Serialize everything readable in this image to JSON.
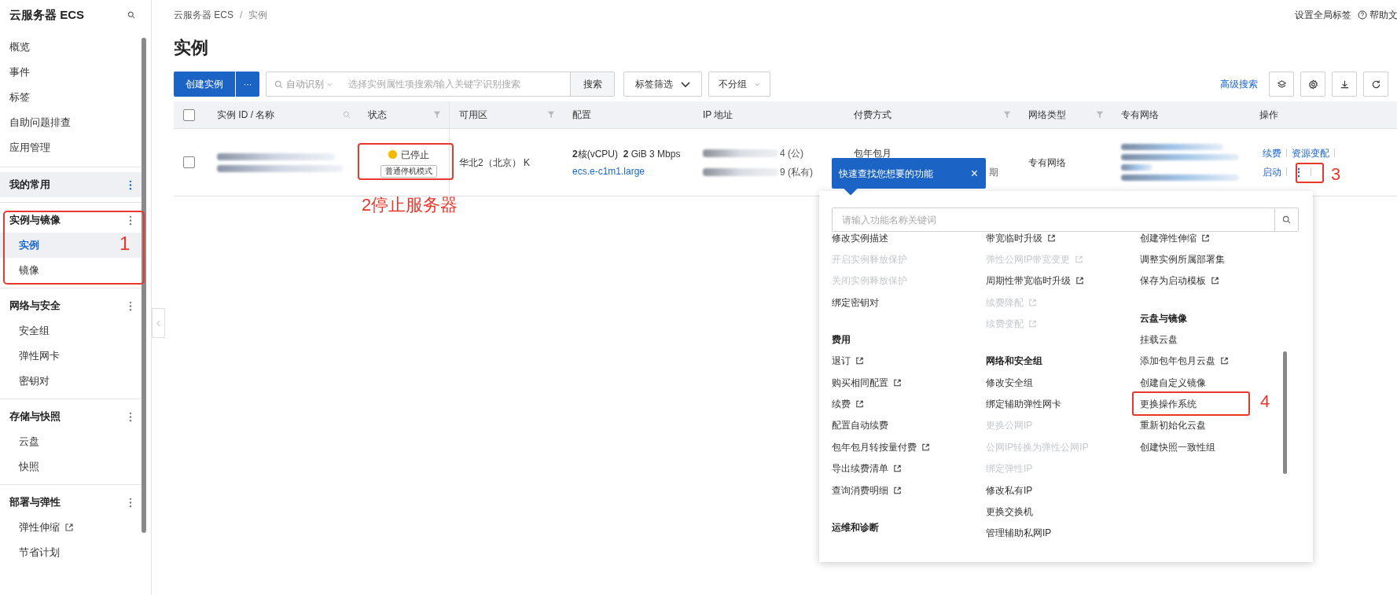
{
  "sidebar": {
    "title": "云服务器 ECS",
    "top_items": [
      {
        "label": "概览"
      },
      {
        "label": "事件"
      },
      {
        "label": "标签"
      },
      {
        "label": "自助问题排查"
      },
      {
        "label": "应用管理"
      }
    ],
    "sections": [
      {
        "title": "我的常用",
        "selected": true
      },
      {
        "title": "实例与镜像",
        "selected": false,
        "items": [
          {
            "label": "实例",
            "selected": true,
            "external": false
          },
          {
            "label": "镜像",
            "selected": false,
            "external": false
          }
        ]
      },
      {
        "title": "网络与安全",
        "selected": false,
        "items": [
          {
            "label": "安全组",
            "selected": false,
            "external": false
          },
          {
            "label": "弹性网卡",
            "selected": false,
            "external": false
          },
          {
            "label": "密钥对",
            "selected": false,
            "external": false
          }
        ]
      },
      {
        "title": "存储与快照",
        "selected": false,
        "items": [
          {
            "label": "云盘",
            "selected": false,
            "external": false
          },
          {
            "label": "快照",
            "selected": false,
            "external": false
          }
        ]
      },
      {
        "title": "部署与弹性",
        "selected": false,
        "items": [
          {
            "label": "弹性伸缩",
            "selected": false,
            "external": true
          },
          {
            "label": "节省计划",
            "selected": false,
            "external": false
          }
        ]
      }
    ]
  },
  "breadcrumb": {
    "items": [
      "云服务器 ECS",
      "实例"
    ],
    "separator": "/"
  },
  "header_links": [
    {
      "label": "设置全局标签",
      "kind": "text"
    },
    {
      "label": "帮助文",
      "kind": "help"
    }
  ],
  "page_title": "实例",
  "toolbar": {
    "create_button": "创建实例",
    "more_button": "···",
    "search_scope": "自动识别",
    "search_placeholder": "选择实例属性项搜索/输入关键字识别搜索",
    "search_button": "搜索",
    "tag_filter": "标签筛选",
    "group_select": "不分组",
    "advanced_search": "高级搜索"
  },
  "table": {
    "all_selected": false,
    "columns": [
      {
        "label": "实例 ID / 名称"
      },
      {
        "label": "状态"
      },
      {
        "label": "可用区"
      },
      {
        "label": "配置"
      },
      {
        "label": "IP 地址"
      },
      {
        "label": "付费方式"
      },
      {
        "label": "网络类型"
      },
      {
        "label": "专有网络"
      },
      {
        "label": "操作"
      }
    ],
    "rows": [
      {
        "checked": false,
        "status": "已停止",
        "stop_mode": "普通停机模式",
        "zone": "华北2（北京） K",
        "config_main": "**2**核(vCPU)  **2** GiB 3 Mbps",
        "instance_type": "ecs.e-c1m1.large",
        "ip_public_suffix": "4 (公)",
        "ip_private_suffix": "9 (私有)",
        "payment": "包年包月",
        "payment_tail": "期",
        "network_type": "专有网络",
        "actions": [
          {
            "label": "续费",
            "kind": "link"
          },
          {
            "label": "资源变配",
            "kind": "link"
          },
          {
            "label": "启动",
            "kind": "link"
          },
          {
            "label": "⋮",
            "kind": "more"
          }
        ]
      }
    ]
  },
  "tooltip": {
    "text": "快速查找您想要的功能",
    "close": "×"
  },
  "menu": {
    "search_placeholder": "请输入功能名称关键词",
    "columns": [
      [
        {
          "items": [
            {
              "label": "修改实例描述",
              "disabled": false,
              "external": false
            },
            {
              "label": "开启实例释放保护",
              "disabled": true,
              "external": false
            },
            {
              "label": "关闭实例释放保护",
              "disabled": true,
              "external": false
            },
            {
              "label": "绑定密钥对",
              "disabled": false,
              "external": false
            }
          ]
        },
        {
          "heading": "费用",
          "items": [
            {
              "label": "退订",
              "disabled": false,
              "external": true
            },
            {
              "label": "购买相同配置",
              "disabled": false,
              "external": true
            },
            {
              "label": "续费",
              "disabled": false,
              "external": true
            },
            {
              "label": "配置自动续费",
              "disabled": false,
              "external": false
            },
            {
              "label": "包年包月转按量付费",
              "disabled": false,
              "external": true
            },
            {
              "label": "导出续费清单",
              "disabled": false,
              "external": true
            },
            {
              "label": "查询消费明细",
              "disabled": false,
              "external": true
            }
          ]
        },
        {
          "heading": "运维和诊断"
        }
      ],
      [
        {
          "items": [
            {
              "label": "带宽临时升级",
              "disabled": false,
              "external": true
            },
            {
              "label": "弹性公网IP带宽变更",
              "disabled": true,
              "external": true
            },
            {
              "label": "周期性带宽临时升级",
              "disabled": false,
              "external": true
            },
            {
              "label": "续费降配",
              "disabled": true,
              "external": true
            },
            {
              "label": "续费变配",
              "disabled": true,
              "external": true
            }
          ]
        },
        {
          "heading": "网络和安全组",
          "items": [
            {
              "label": "修改安全组",
              "disabled": false,
              "external": false
            },
            {
              "label": "绑定辅助弹性网卡",
              "disabled": false,
              "external": false
            },
            {
              "label": "更换公网IP",
              "disabled": true,
              "external": false
            },
            {
              "label": "公网IP转换为弹性公网IP",
              "disabled": true,
              "external": false
            },
            {
              "label": "绑定弹性IP",
              "disabled": true,
              "external": false
            },
            {
              "label": "修改私有IP",
              "disabled": false,
              "external": false
            },
            {
              "label": "更换交换机",
              "disabled": false,
              "external": false
            },
            {
              "label": "管理辅助私网IP",
              "disabled": false,
              "external": false
            }
          ]
        }
      ],
      [
        {
          "items": [
            {
              "label": "创建弹性伸缩",
              "disabled": false,
              "external": true
            },
            {
              "label": "调整实例所属部署集",
              "disabled": false,
              "external": false
            },
            {
              "label": "保存为启动模板",
              "disabled": false,
              "external": true
            }
          ]
        },
        {
          "heading": "云盘与镜像",
          "items": [
            {
              "label": "挂载云盘",
              "disabled": false,
              "external": false
            },
            {
              "label": "添加包年包月云盘",
              "disabled": false,
              "external": true
            },
            {
              "label": "创建自定义镜像",
              "disabled": false,
              "external": false
            },
            {
              "label": "更换操作系统",
              "disabled": false,
              "external": false
            },
            {
              "label": "重新初始化云盘",
              "disabled": false,
              "external": false
            },
            {
              "label": "创建快照一致性组",
              "disabled": false,
              "external": false
            }
          ]
        }
      ]
    ]
  },
  "annotations": [
    {
      "label": "1",
      "kind": "sidebar"
    },
    {
      "label": "2停止服务器",
      "kind": "status"
    },
    {
      "label": "3",
      "kind": "more"
    },
    {
      "label": "4",
      "kind": "menu"
    }
  ]
}
